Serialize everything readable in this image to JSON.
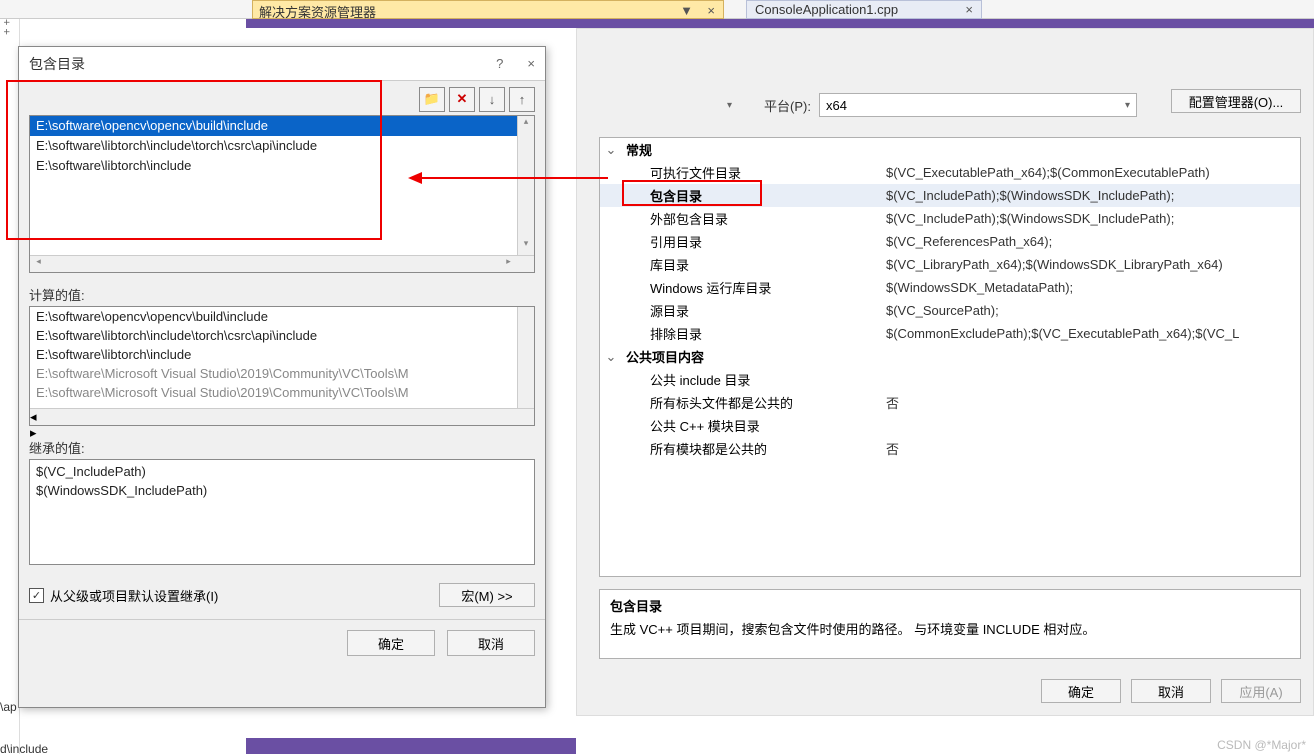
{
  "ide": {
    "solution_explorer_tab": "解决方案资源管理器",
    "file_tab": "ConsoleApplication1.cpp",
    "left_snippet1": "\\ap",
    "left_snippet2": "d\\include"
  },
  "prop": {
    "platform_label": "平台(P):",
    "platform_value": "x64",
    "config_manager_btn": "配置管理器(O)...",
    "help_btn": "?",
    "close_btn": "×",
    "groups": {
      "general": "常规",
      "public": "公共项目内容"
    },
    "rows": [
      {
        "k": "可执行文件目录",
        "v": "$(VC_ExecutablePath_x64);$(CommonExecutablePath)"
      },
      {
        "k": "包含目录",
        "v": "$(VC_IncludePath);$(WindowsSDK_IncludePath);"
      },
      {
        "k": "外部包含目录",
        "v": "$(VC_IncludePath);$(WindowsSDK_IncludePath);"
      },
      {
        "k": "引用目录",
        "v": "$(VC_ReferencesPath_x64);"
      },
      {
        "k": "库目录",
        "v": "$(VC_LibraryPath_x64);$(WindowsSDK_LibraryPath_x64)"
      },
      {
        "k": "Windows 运行库目录",
        "v": "$(WindowsSDK_MetadataPath);"
      },
      {
        "k": "源目录",
        "v": "$(VC_SourcePath);"
      },
      {
        "k": "排除目录",
        "v": "$(CommonExcludePath);$(VC_ExecutablePath_x64);$(VC_L"
      }
    ],
    "pubrows": [
      {
        "k": "公共 include 目录",
        "v": ""
      },
      {
        "k": "所有标头文件都是公共的",
        "v": "否"
      },
      {
        "k": "公共 C++ 模块目录",
        "v": ""
      },
      {
        "k": "所有模块都是公共的",
        "v": "否"
      }
    ],
    "help_title": "包含目录",
    "help_text": "生成 VC++ 项目期间，搜索包含文件时使用的路径。   与环境变量 INCLUDE 相对应。",
    "ok": "确定",
    "cancel": "取消",
    "apply": "应用(A)"
  },
  "inc": {
    "title": "包含目录",
    "help": "?",
    "close": "×",
    "icons": {
      "folder": "📁",
      "delete": "✕",
      "down": "↓",
      "up": "↑"
    },
    "items": [
      "E:\\software\\opencv\\opencv\\build\\include",
      "E:\\software\\libtorch\\include\\torch\\csrc\\api\\include",
      "E:\\software\\libtorch\\include"
    ],
    "calc_label": "计算的值:",
    "calc_items": [
      "E:\\software\\opencv\\opencv\\build\\include",
      "E:\\software\\libtorch\\include\\torch\\csrc\\api\\include",
      "E:\\software\\libtorch\\include",
      "E:\\software\\Microsoft Visual Studio\\2019\\Community\\VC\\Tools\\M",
      "E:\\software\\Microsoft Visual Studio\\2019\\Community\\VC\\Tools\\M"
    ],
    "inherit_label": "继承的值:",
    "inherit_items": [
      "$(VC_IncludePath)",
      "$(WindowsSDK_IncludePath)"
    ],
    "inherit_checkbox": "从父级或项目默认设置继承(I)",
    "macros_btn": "宏(M) >>",
    "ok": "确定",
    "cancel": "取消"
  },
  "watermark": "CSDN @*Major*"
}
